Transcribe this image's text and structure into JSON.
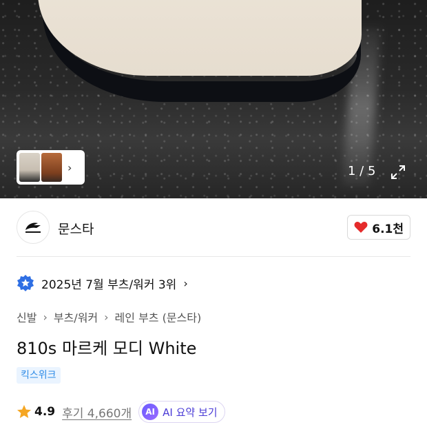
{
  "gallery": {
    "counter": "1 / 5",
    "thumbnail_icon": "chevron-right-icon",
    "expand_icon": "expand-icon"
  },
  "brand": {
    "name": "문스타",
    "logo_icon": "brand-logo-icon",
    "like_icon": "heart-icon",
    "like_count": "6.1천"
  },
  "ranking": {
    "icon": "ranking-medal-icon",
    "text": "2025년 7월 부츠/워커 3위"
  },
  "breadcrumb": [
    "신발",
    "부츠/워커",
    "레인 부츠 (문스타)"
  ],
  "product": {
    "title": "810s 마르케 모디 White",
    "tag": "킥스위크"
  },
  "rating": {
    "star_icon": "star-icon",
    "value": "4.9",
    "review_label": "후기 4,660개",
    "ai_badge": "AI",
    "ai_label": "AI 요약 보기"
  },
  "colors": {
    "heart": "#e52b2b",
    "star": "#f5a623",
    "tag_text": "#2b8ae6",
    "ai_accent": "#6a5cff"
  }
}
